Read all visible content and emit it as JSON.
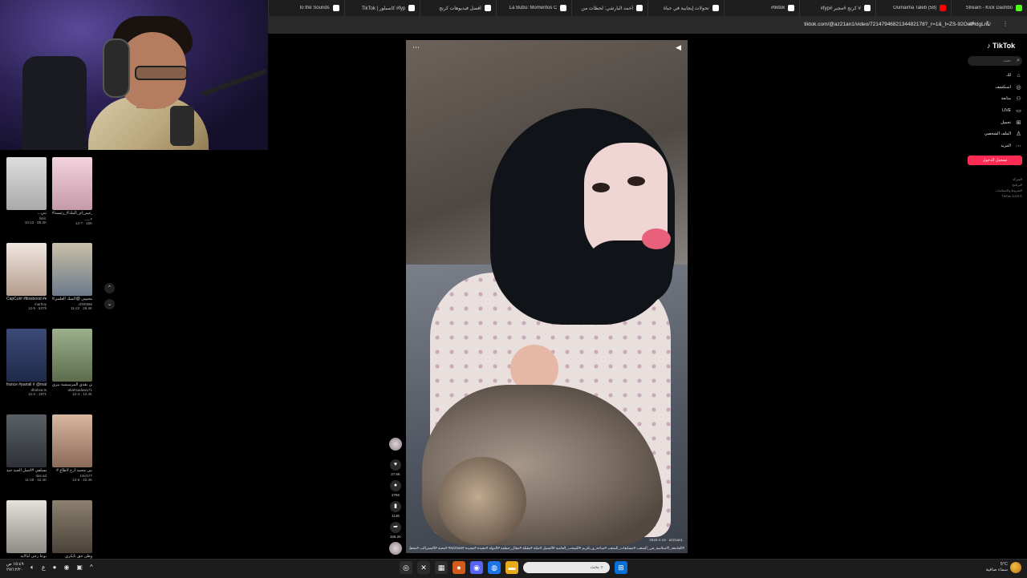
{
  "browser": {
    "tabs": [
      {
        "title": "Stream - Kick Dashbo",
        "color": "#53fc18"
      },
      {
        "title": "Oumaima Taleb (58)",
        "color": "#ff0000"
      },
      {
        "title": "#fyp# كرنج #مجبر #",
        "color": "#ffffff"
      },
      {
        "title": "#tiktok",
        "color": "#ffffff"
      },
      {
        "title": "تحولات إيجابية في حياة",
        "color": "#ffffff"
      },
      {
        "title": "أحمد البارشي: لحظات من",
        "color": "#ffffff"
      },
      {
        "title": "La Bubu: Momentos C",
        "color": "#ffffff"
      },
      {
        "title": "أفضل فيديوهات كرنج",
        "color": "#ffffff"
      },
      {
        "title": "TikTok | كاسبلور #fyp",
        "color": "#ffffff"
      },
      {
        "title": "to the Sounds",
        "color": "#ffffff"
      }
    ],
    "url": "tiktok.com/@az21an1/video/7214794682134482178?_r=1&_t=ZS-92OeIHdgLnL"
  },
  "recommended": [
    {
      "caption": "...تتي",
      "author": "limit.",
      "meta": "10-13 · 89.2K"
    },
    {
      "caption": "#زعيم_أم_المك#_رئيسة",
      "author": "___ه",
      "meta": "12-7 · 16K"
    },
    {
      "caption": "CapCut# #tlissbood #eyta",
      "author": "marhoy",
      "meta": "12-5 · 5379"
    },
    {
      "caption": "#مسحيييي @الميك العلمي",
      "author": "chhh955",
      "meta": "11-22 · 29.4K"
    },
    {
      "caption": "france #pariall # @mal#",
      "author": "dhahsa.ts",
      "meta": "12-2 · 1971"
    },
    {
      "caption": "قابي بقدي المرسيسة بيري",
      "author": "abahsadawu71",
      "meta": "12-4 · 12.4K"
    },
    {
      "caption": "لمسحك قلا مسلقي #أجمل الجيد حيد",
      "author": "das.ad",
      "meta": "11-28 · 42.4K"
    },
    {
      "caption": "# بين محمد ارح لاطاع",
      "author": "zinch77",
      "meta": "12-5 · 42.4K"
    },
    {
      "caption": "نوعا رحى لبالاية",
      "author": "",
      "meta": ""
    },
    {
      "caption": "وطن حق تايكري",
      "author": "",
      "meta": ""
    }
  ],
  "video": {
    "caption": "#الجامعة_الاسلامية_في_الشعب #مسابقات_الشعب #مباخة_و_تكريم #الشخب_العامية #التمتيل #مثلة #مقتلة #مقال_حطمة #الدولة #معيدة #مجيدة #az21an# #محبة #اكشنراكب #محفل",
    "stamp": "2023-1-14 · az21an1",
    "likes": "37.6K",
    "comments": "2756",
    "saves": "1136",
    "shares": "166.2K"
  },
  "tiktok": {
    "logo": "TikTok",
    "search_placeholder": "بحث",
    "nav": [
      {
        "label": "لك",
        "icon": "home-icon"
      },
      {
        "label": "استكشف",
        "icon": "explore-icon"
      },
      {
        "label": "متابعة",
        "icon": "following-icon"
      },
      {
        "label": "LIVE",
        "icon": "live-icon"
      },
      {
        "label": "تحميل",
        "icon": "upload-icon"
      },
      {
        "label": "الملف الشخصي",
        "icon": "profile-icon"
      },
      {
        "label": "المزيد",
        "icon": "more-icon"
      }
    ],
    "login": "تسجيل الدخول",
    "footer": [
      "الشركة",
      "البرنامج",
      "الشروط والسياسات",
      "TikTok 2025 ©"
    ]
  },
  "taskbar": {
    "time": "١٥:٤٩ ص",
    "date": "٢٧/١٢/٢٠",
    "search_placeholder": "بحث",
    "temp": "5°C",
    "weather": "سماء صافية"
  }
}
